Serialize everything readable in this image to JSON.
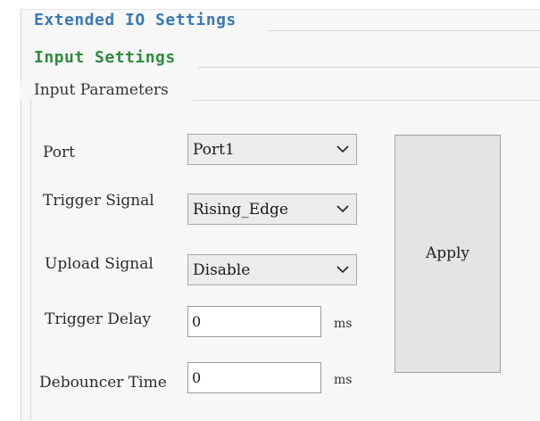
{
  "sections": {
    "extended_io": "Extended IO Settings",
    "input_settings": "Input Settings",
    "input_parameters": "Input Parameters"
  },
  "fields": {
    "port": {
      "label": "Port",
      "value": "Port1"
    },
    "trigger_signal": {
      "label": "Trigger Signal",
      "value": "Rising_Edge"
    },
    "upload_signal": {
      "label": "Upload Signal",
      "value": "Disable"
    },
    "trigger_delay": {
      "label": "Trigger Delay",
      "value": "0",
      "unit": "ms"
    },
    "debouncer_time": {
      "label": "Debouncer Time",
      "value": "0",
      "unit": "ms"
    }
  },
  "apply_label": "Apply",
  "icons": {
    "dropdown": "chevron-down-icon"
  },
  "colors": {
    "section_blue": "#3a79b8",
    "section_green": "#2e8b3e"
  }
}
